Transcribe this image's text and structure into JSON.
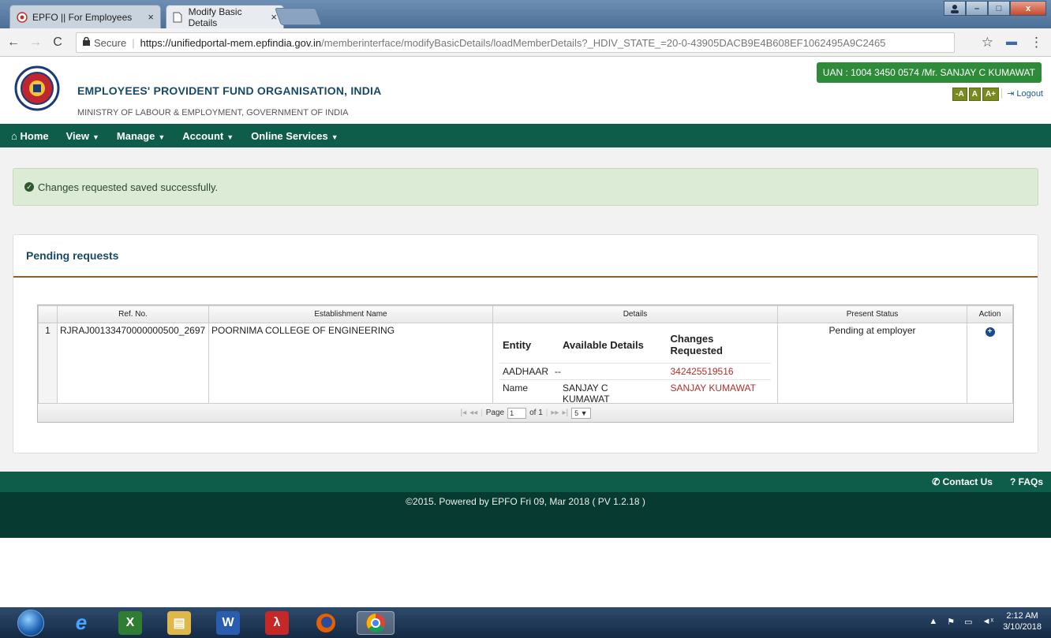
{
  "browser": {
    "tabs": [
      {
        "title": "EPFO || For Employees"
      },
      {
        "title": "Modify Basic Details"
      }
    ],
    "tab_close_glyph": "×",
    "window_buttons": {
      "minimize": "–",
      "maximize": "□",
      "close": "x"
    },
    "secure_label": "Secure",
    "url_host": "https://unifiedportal-mem.epfindia.gov.in",
    "url_path": "/memberinterface/modifyBasicDetails/loadMemberDetails?_HDIV_STATE_=20-0-43905DACB9E4B608EF1062495A9C2465"
  },
  "header": {
    "org_name": "EMPLOYEES' PROVIDENT FUND ORGANISATION, INDIA",
    "ministry": "MINISTRY OF LABOUR & EMPLOYMENT, GOVERNMENT OF INDIA",
    "uan_text": "UAN : 1004 3450 0574 /Mr. SANJAY C KUMAWAT",
    "font_controls": [
      "-A",
      "A",
      "A+"
    ],
    "logout_label": "Logout"
  },
  "nav": {
    "home": "Home",
    "items": [
      "View",
      "Manage",
      "Account",
      "Online Services"
    ]
  },
  "alert": {
    "message": "Changes requested saved successfully."
  },
  "pending": {
    "title": "Pending requests",
    "columns": [
      "Ref. No.",
      "Establishment Name",
      "Details",
      "Present Status",
      "Action"
    ],
    "rows": [
      {
        "index": "1",
        "ref_no": "RJRAJ00133470000000500_2697",
        "establishment": "POORNIMA COLLEGE OF ENGINEERING",
        "details_header": [
          "Entity",
          "Available Details",
          "Changes Requested"
        ],
        "details": [
          {
            "entity": "AADHAAR",
            "available": "--",
            "requested": "342425519516"
          },
          {
            "entity": "Name",
            "available": "SANJAY C KUMAWAT",
            "requested": "SANJAY KUMAWAT"
          }
        ],
        "status": "Pending at employer"
      }
    ],
    "pager": {
      "page_label": "Page",
      "page_value": "1",
      "of_label": "of 1",
      "page_size": "5"
    }
  },
  "footer": {
    "contact": "Contact Us",
    "faqs": "FAQs",
    "copyright": "©2015. Powered by EPFO Fri 09, Mar 2018 ( PV 1.2.18 )"
  },
  "taskbar": {
    "time": "2:12 AM",
    "date": "3/10/2018"
  },
  "colors": {
    "nav_green": "#0d5d4a",
    "footer_dark": "#073a30",
    "uan_green": "#2e8b3a",
    "alert_bg": "#dcebd6",
    "requested_red": "#b0302a",
    "title_blue": "#184a66"
  }
}
